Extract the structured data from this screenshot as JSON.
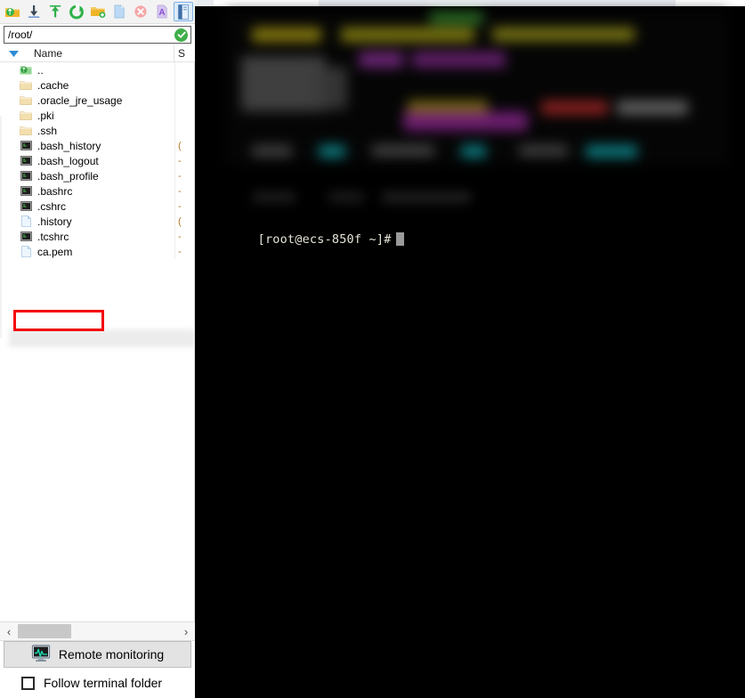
{
  "app": {
    "name": "sftp-file-browser-with-terminal"
  },
  "sftp": {
    "toolbar": {
      "buttons": [
        {
          "name": "parent-folder-icon",
          "title": "Up one level"
        },
        {
          "name": "download-icon",
          "title": "Download"
        },
        {
          "name": "upload-icon",
          "title": "Upload"
        },
        {
          "name": "refresh-icon",
          "title": "Refresh"
        },
        {
          "name": "new-folder-icon",
          "title": "New folder"
        },
        {
          "name": "new-file-icon",
          "title": "New file"
        },
        {
          "name": "delete-icon",
          "title": "Delete"
        },
        {
          "name": "rename-icon",
          "title": "Rename"
        },
        {
          "name": "toggle-panel-icon",
          "title": "Show/hide panel"
        }
      ]
    },
    "address": {
      "value": "/root/",
      "placeholder": "/root/",
      "status": "ok"
    },
    "columns": [
      {
        "key": "name",
        "label": "Name"
      },
      {
        "key": "size",
        "label": "S"
      }
    ],
    "sort": {
      "column": "Name",
      "direction": "desc"
    },
    "files": [
      {
        "icon": "parent-folder-icon",
        "name": "..",
        "size": "",
        "type": "parent"
      },
      {
        "icon": "folder-icon",
        "name": ".cache",
        "size": "",
        "type": "folder"
      },
      {
        "icon": "folder-icon",
        "name": ".oracle_jre_usage",
        "size": "",
        "type": "folder"
      },
      {
        "icon": "folder-icon",
        "name": ".pki",
        "size": "",
        "type": "folder"
      },
      {
        "icon": "folder-icon",
        "name": ".ssh",
        "size": "",
        "type": "folder"
      },
      {
        "icon": "script-file-icon",
        "name": ".bash_history",
        "size": "(",
        "type": "file"
      },
      {
        "icon": "script-file-icon",
        "name": ".bash_logout",
        "size": "-",
        "type": "file"
      },
      {
        "icon": "script-file-icon",
        "name": ".bash_profile",
        "size": "-",
        "type": "file"
      },
      {
        "icon": "script-file-icon",
        "name": ".bashrc",
        "size": "-",
        "type": "file"
      },
      {
        "icon": "script-file-icon",
        "name": ".cshrc",
        "size": "-",
        "type": "file"
      },
      {
        "icon": "document-file-icon",
        "name": ".history",
        "size": "(",
        "type": "file"
      },
      {
        "icon": "script-file-icon",
        "name": ".tcshrc",
        "size": "-",
        "type": "file"
      },
      {
        "icon": "document-file-icon",
        "name": "ca.pem",
        "size": "-",
        "type": "file"
      }
    ],
    "highlight": {
      "target": "ca.pem",
      "color": "#f4060b"
    },
    "scrollbar": {
      "left_arrow": "‹",
      "right_arrow": "›"
    },
    "remote_monitoring": {
      "label": "Remote monitoring",
      "icon": "monitor-waveform-icon"
    },
    "follow_terminal": {
      "label": "Follow terminal folder",
      "checked": false
    }
  },
  "terminal": {
    "prompt": "[root@ecs-850f ~]#",
    "user": "root",
    "host": "ecs-850f",
    "cwd": "~",
    "banner_redacted": true,
    "banner_note": ""
  },
  "colors": {
    "accent_green": "#3fae49",
    "highlight_red": "#f4060b",
    "terminal_bg": "#000000",
    "terminal_fg": "#d6d6d6",
    "folder": "#f7dfa5"
  }
}
